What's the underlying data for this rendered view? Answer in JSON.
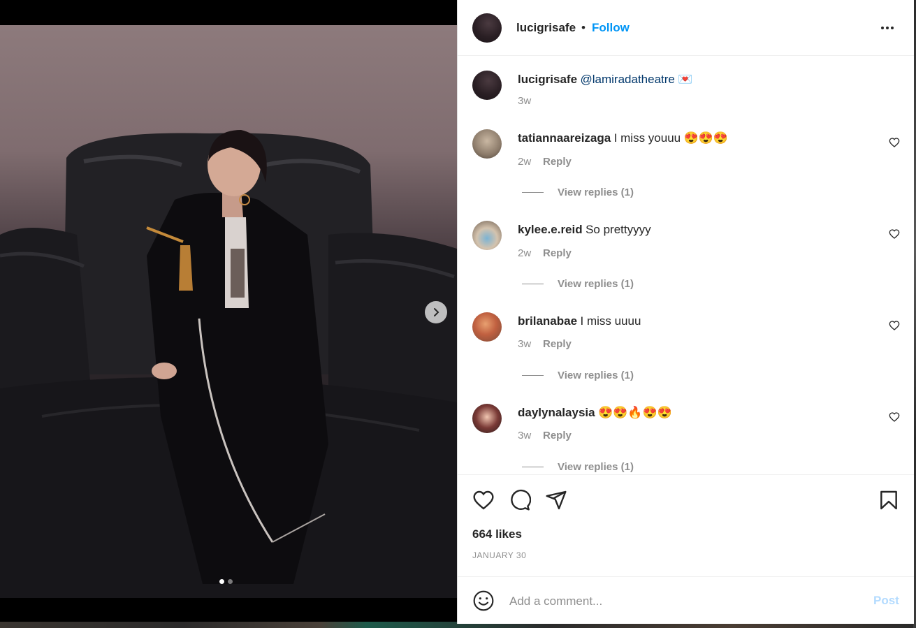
{
  "post": {
    "username": "lucigrisafe",
    "follow_label": "Follow",
    "separator": "•",
    "caption": {
      "username": "lucigrisafe",
      "mention": "@lamiradatheatre",
      "emoji": "💌",
      "age": "3w"
    }
  },
  "comments": [
    {
      "username": "tatiannaareizaga",
      "text": "I miss youuu",
      "emoji": "😍😍😍",
      "age": "2w",
      "reply_label": "Reply",
      "view_replies": "View replies (1)"
    },
    {
      "username": "kylee.e.reid",
      "text": "So prettyyyy",
      "emoji": "",
      "age": "2w",
      "reply_label": "Reply",
      "view_replies": "View replies (1)"
    },
    {
      "username": "brilanabae",
      "text": "I miss uuuu",
      "emoji": "",
      "age": "3w",
      "reply_label": "Reply",
      "view_replies": "View replies (1)"
    },
    {
      "username": "daylynalaysia",
      "text": "",
      "emoji": "😍😍🔥😍😍",
      "age": "3w",
      "reply_label": "Reply",
      "view_replies": "View replies (1)"
    }
  ],
  "engagement": {
    "likes": "664 likes",
    "date": "JANUARY 30"
  },
  "composer": {
    "placeholder": "Add a comment...",
    "post_label": "Post"
  },
  "carousel": {
    "count": 2,
    "active_index": 0
  },
  "icons": {
    "more": "more-options-icon",
    "like": "heart-icon",
    "comment": "comment-icon",
    "share": "share-icon",
    "save": "bookmark-icon",
    "emoji": "emoji-icon",
    "next": "chevron-right-icon"
  }
}
